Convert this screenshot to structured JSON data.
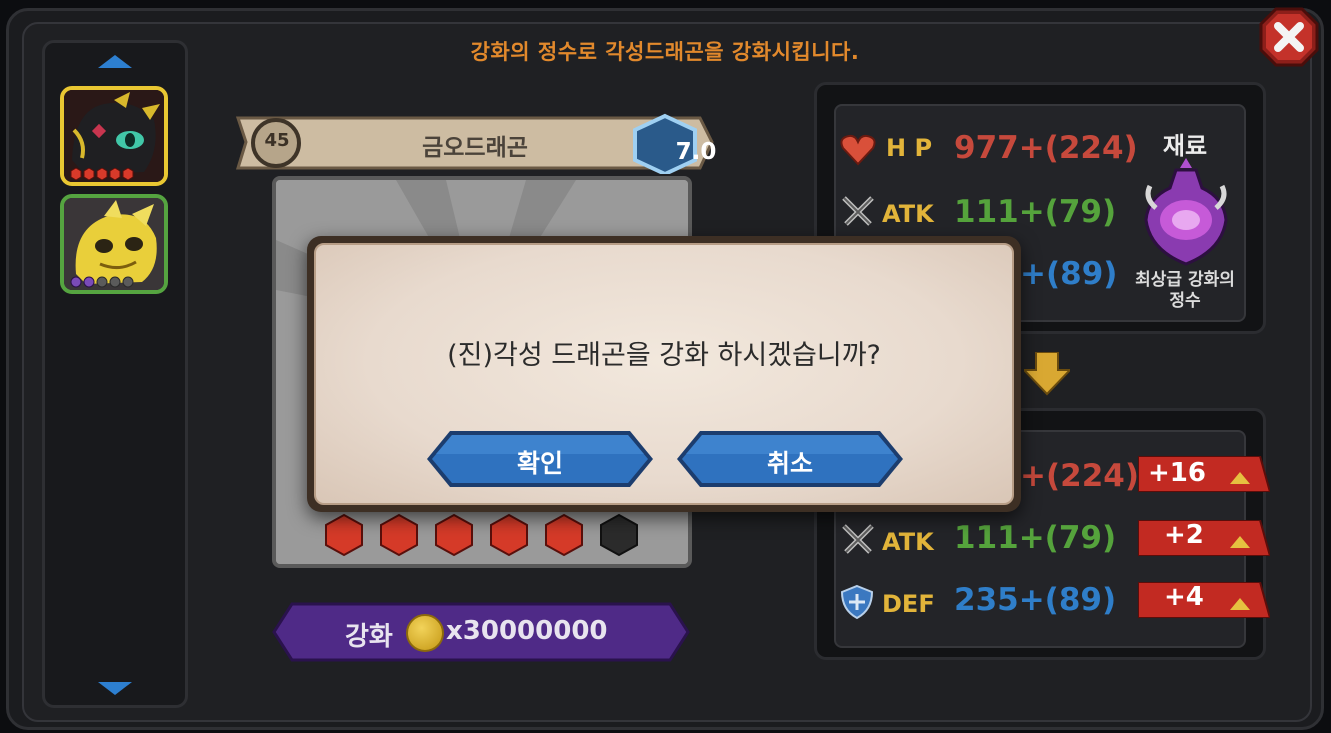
{
  "header": {
    "instruction": "강화의 정수로 각성드래곤을 강화시킵니다."
  },
  "close_button": {
    "icon": "close-x-icon"
  },
  "roster": {
    "up_icon": "arrow-up-icon",
    "down_icon": "arrow-down-icon",
    "slots": [
      {
        "name": "black-dragon",
        "stars": 5,
        "star_color": "#d83a2a",
        "selected": true
      },
      {
        "name": "yellow-dragon",
        "stars": 5,
        "star_color": "#7a4bb8",
        "selected": false
      }
    ]
  },
  "dragon": {
    "name": "금오드래곤",
    "level": "45",
    "grade": "7.0",
    "stars_filled": 5,
    "stars_total": 6
  },
  "upgrade": {
    "label": "강화",
    "cost": "x30000000",
    "coin_icon": "gold-coin-icon"
  },
  "stats_current": {
    "hp": {
      "label": "H P",
      "value": "977+(224)"
    },
    "atk": {
      "label": "ATK",
      "value": "111+(79)"
    },
    "def": {
      "value": "+(89)"
    }
  },
  "material": {
    "title": "재료",
    "name_line1": "최상급 강화의",
    "name_line2": "정수"
  },
  "stats_after": {
    "hp": {
      "value": "+(224)",
      "gain": "+16"
    },
    "atk": {
      "label": "ATK",
      "value": "111+(79)",
      "gain": "+2"
    },
    "def": {
      "label": "DEF",
      "value": "235+(89)",
      "gain": "+4"
    }
  },
  "dialog": {
    "message": "(진)각성 드래곤을 강화 하시겠습니까?",
    "confirm_label": "확인",
    "cancel_label": "취소"
  },
  "colors": {
    "accent_orange": "#e2892c",
    "hp_red": "#c6493c",
    "atk_green": "#55a33c",
    "def_blue": "#2f7ec9",
    "button_blue": "#2f72bf",
    "gain_red": "#c22a22",
    "upgrade_purple": "#4f2a87"
  }
}
